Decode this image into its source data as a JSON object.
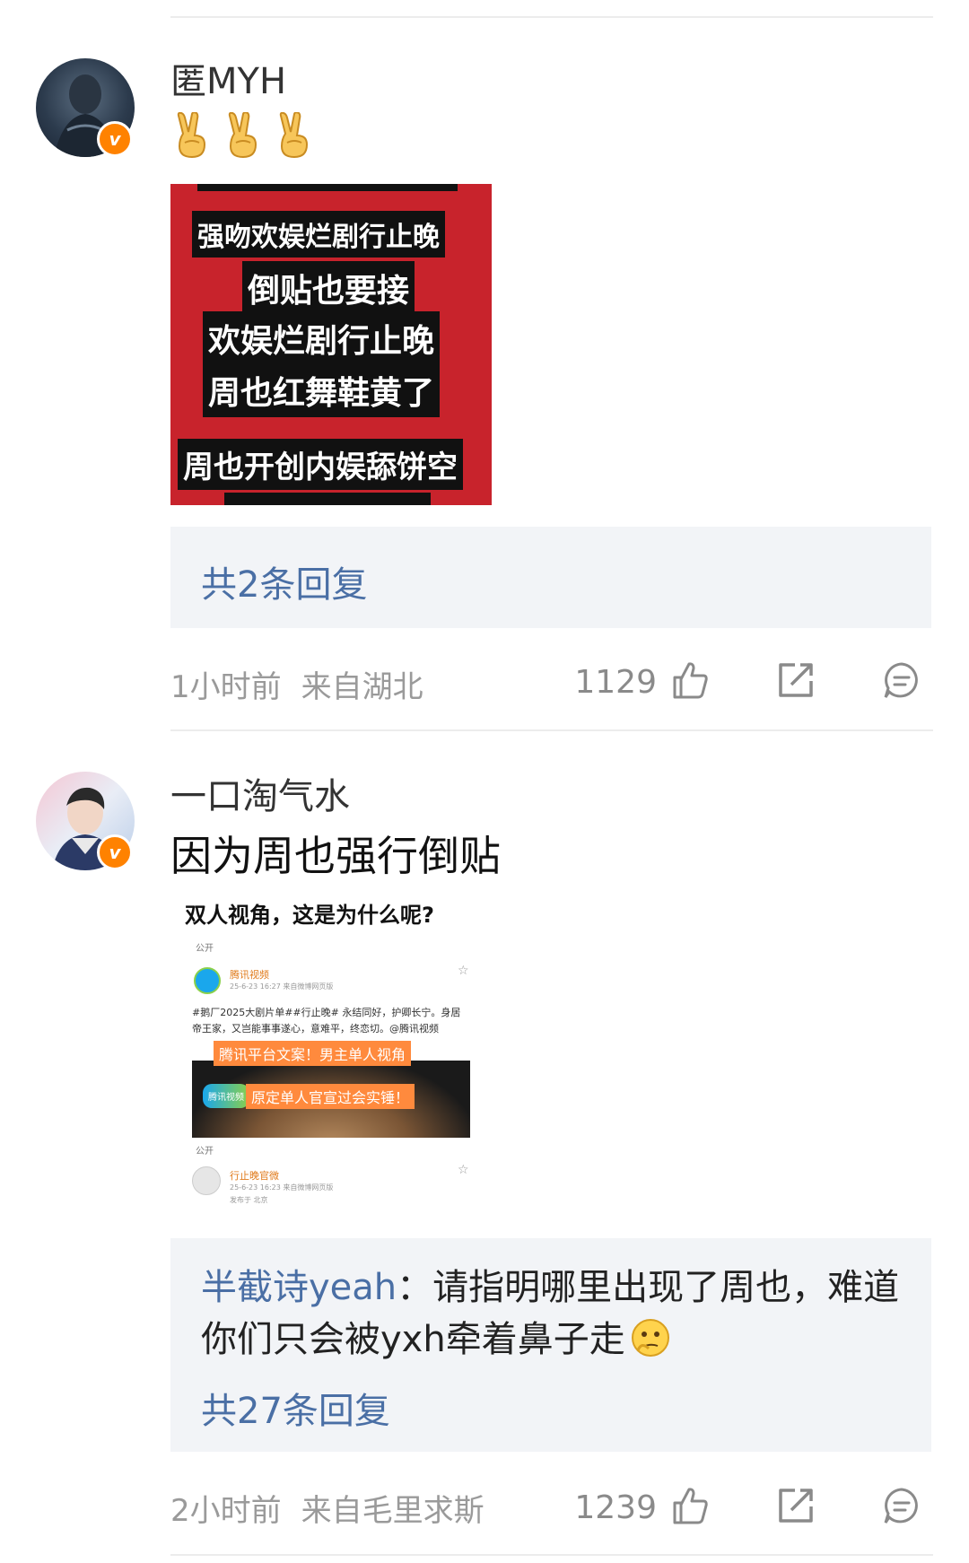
{
  "comments": [
    {
      "username": "匿MYH",
      "text_emojis": [
        "victory-hand",
        "victory-hand",
        "victory-hand"
      ],
      "image_lines": [
        "强吻欢娱烂剧行止晚",
        "倒贴也要接",
        "欢娱烂剧行止晚",
        "周也红舞鞋黄了",
        "周也开创内娱舔饼空"
      ],
      "replies": [],
      "reply_count": "共2条回复",
      "time": "1小时前",
      "location": "来自湖北",
      "likes": "1129"
    },
    {
      "username": "一口淘气水",
      "text": "因为周也强行倒贴",
      "image": {
        "caption": "双人视角，这是为什么呢?",
        "public1": "公开",
        "account1": "腾讯视频",
        "date1": "25-6-23 16:27 来自微博网页版",
        "post_text": "#鹅厂2025大剧片单##行止晚# 永结同好，护卿长宁。身居帝王家，又岂能事事遂心，意难平，终恋切。@腾讯视频",
        "overlay1": "腾讯平台文案！男主单人视角",
        "logo_text": "腾讯视频",
        "overlay2": "原定单人官宣过会实锤！",
        "public2": "公开",
        "account2": "行止晚官微",
        "date2": "25-6-23 16:23 来自微博网页版",
        "from2": "发布于 北京"
      },
      "replies": [
        {
          "user": "半截诗yeah",
          "text": "：请指明哪里出现了周也，难道你们只会被yxh牵着鼻子走"
        }
      ],
      "reply_count": "共27条回复",
      "time": "2小时前",
      "location": "来自毛里求斯",
      "likes": "1239"
    }
  ],
  "colors": {
    "link": "#4a6fa5",
    "badge": "#ff8200",
    "poster_bg": "#c8232c"
  }
}
